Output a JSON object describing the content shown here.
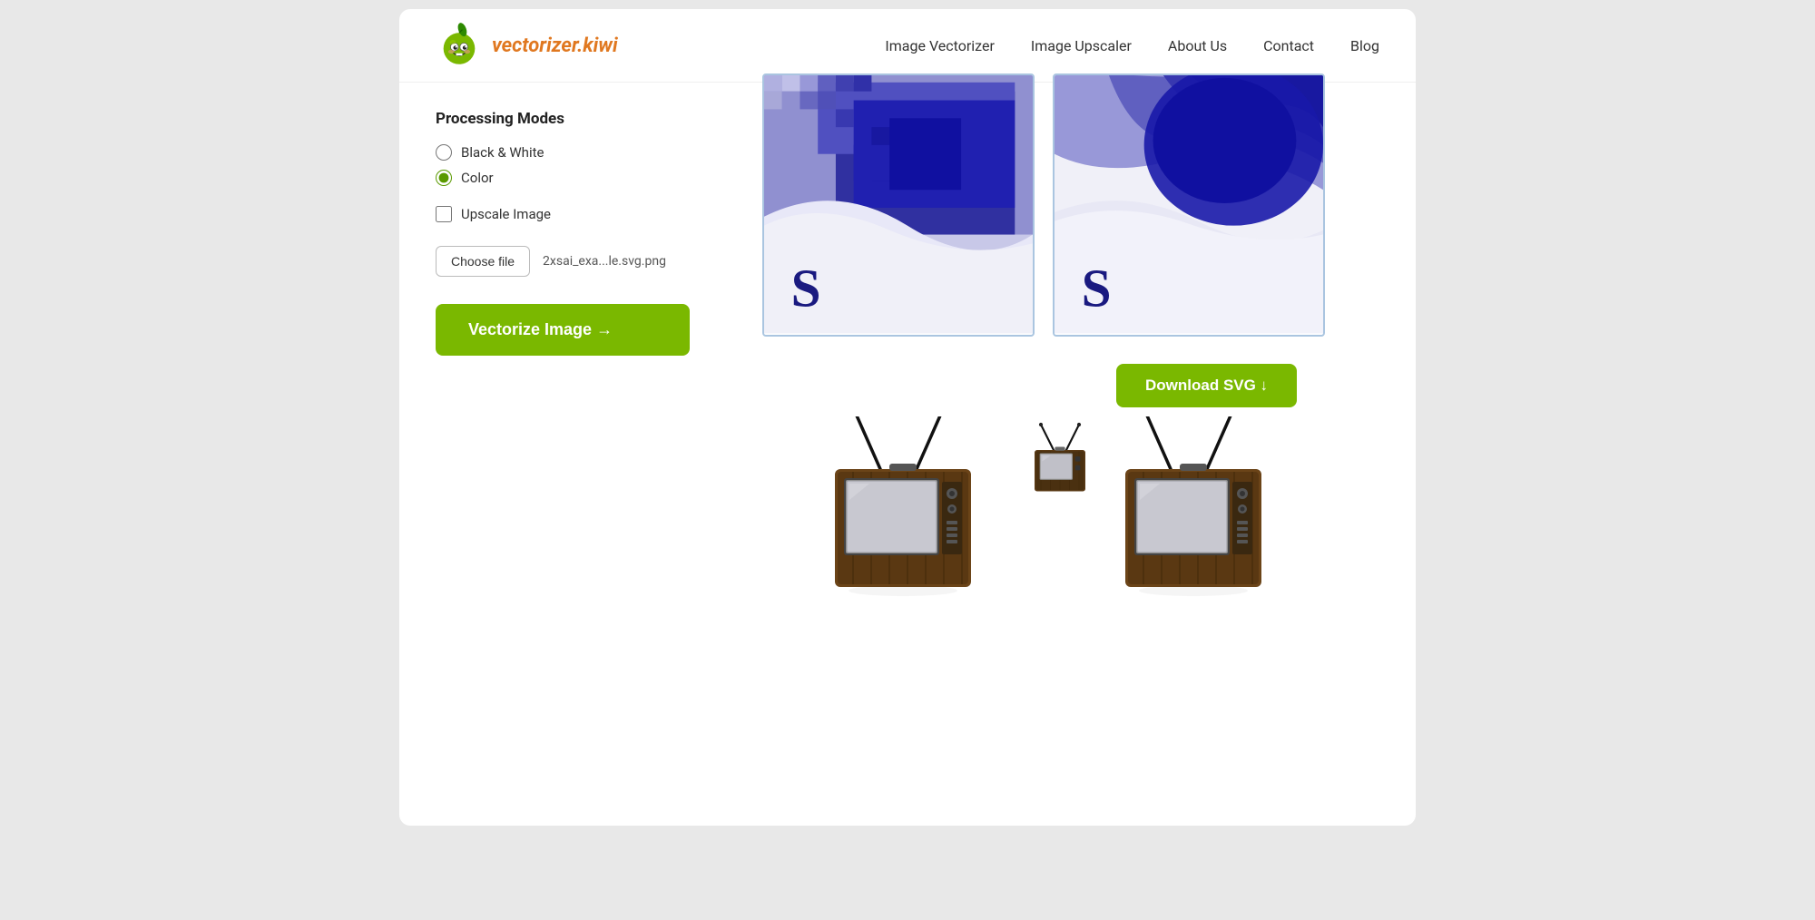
{
  "site": {
    "logo_text": "vectorizer.kiwi",
    "logo_alt": "Kiwi mascot logo"
  },
  "nav": {
    "links": [
      {
        "label": "Image Vectorizer",
        "href": "#"
      },
      {
        "label": "Image Upscaler",
        "href": "#"
      },
      {
        "label": "About Us",
        "href": "#"
      },
      {
        "label": "Contact",
        "href": "#"
      },
      {
        "label": "Blog",
        "href": "#"
      }
    ]
  },
  "sidebar": {
    "processing_modes_title": "Processing Modes",
    "mode_bw_label": "Black & White",
    "mode_color_label": "Color",
    "upscale_label": "Upscale Image",
    "choose_file_label": "Choose file",
    "file_name": "2xsai_exa...le.svg.png",
    "vectorize_btn_label": "Vectorize Image →"
  },
  "main": {
    "download_btn_label": "Download SVG ↓"
  },
  "colors": {
    "green": "#7ab800",
    "orange": "#e07820",
    "nav_text": "#333333",
    "btn_border": "#bbbbbb"
  }
}
